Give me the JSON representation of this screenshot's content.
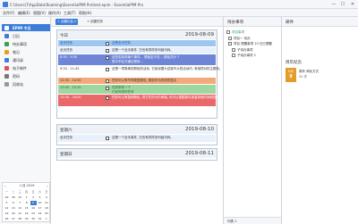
{
  "window": {
    "title": "C:\\Users\\7\\AppData\\Roaming\\EssentialPIM Pro\\test.epim - EssentialPIM Pro",
    "min": "—",
    "max": "☐",
    "close": "✕"
  },
  "menu": [
    "文件(F)",
    "编辑(E)",
    "视图(V)",
    "操作(A)",
    "工具(T)",
    "帮助(H)"
  ],
  "sidebar": {
    "items": [
      {
        "label": "EPIM 今日",
        "color": "#3b7dd8"
      },
      {
        "label": "日历",
        "color": "#3b7dd8"
      },
      {
        "label": "待办事项",
        "color": "#3aa14f"
      },
      {
        "label": "笔记",
        "color": "#e3a21a"
      },
      {
        "label": "通讯录",
        "color": "#3b7dd8"
      },
      {
        "label": "电子邮件",
        "color": "#d9534f"
      },
      {
        "label": "密码",
        "color": "#777777"
      },
      {
        "label": "回收站",
        "color": "#999999"
      }
    ]
  },
  "minical": {
    "month": "八月 2019",
    "prev": "‹",
    "next": "›",
    "dow": [
      "一",
      "二",
      "三",
      "四",
      "五",
      "六",
      "日"
    ],
    "weeks": [
      [
        "29",
        "30",
        "31",
        "1",
        "2",
        "3",
        "4"
      ],
      [
        "5",
        "6",
        "7",
        "8",
        "9",
        "10",
        "11"
      ],
      [
        "12",
        "13",
        "14",
        "15",
        "16",
        "17",
        "18"
      ],
      [
        "19",
        "20",
        "21",
        "22",
        "23",
        "24",
        "25"
      ],
      [
        "26",
        "27",
        "28",
        "29",
        "30",
        "31",
        "1"
      ]
    ],
    "selected": "9"
  },
  "toolbar": {
    "new_event": "+ 创建约会 ▾",
    "new_todo": "+ 创建任务"
  },
  "today": {
    "name": "今日",
    "date": "2019-08-09",
    "events": [
      {
        "time": "全天任务",
        "text": "这是全天任务",
        "text2": "",
        "color": "#9dc7f0",
        "textcolor": "#1a4f9c"
      },
      {
        "time": "全天任务",
        "text": "这是一个全天事件, 它也有同样多列组代码。",
        "text2": "",
        "color": "#e8f0fb",
        "textcolor": "#333333"
      },
      {
        "time": "8:30 - 9:30",
        "text": "这些实际的每个事件。 颜色定义在... 颜色共分 7",
        "text2": "类可不区分通过程序...",
        "color": "#6f86d6",
        "textcolor": "#ffffff"
      },
      {
        "time": "9:30 - 11:45",
        "text": "这是一项简单的颜色的活动, 它就设置为空缺不大的活动内, 有相同对的主题系。",
        "text2": "",
        "color": "#ffffff",
        "textcolor": "#333333"
      },
      {
        "time": "12:30 - 14:30",
        "text": "任务可以有不同类型颜色, 颜色作为完成的显示",
        "text2": "",
        "color": "#f4a97a",
        "textcolor": "#333333"
      },
      {
        "time": "15:00 - 15:30",
        "text": "任务带有一个",
        "text2": "已经完成的任务",
        "color": "#9fd7a0",
        "textcolor": "#2a6a2a"
      },
      {
        "time": "15:30 - 16:00",
        "text": "任务可以有各种颜色, 将它们作为时间轴, 你可以根据事件或者其他时间段进行显示颜色",
        "text2": "",
        "color": "#e9696b",
        "textcolor": "#ffffff"
      }
    ]
  },
  "saturday": {
    "name": "星期六",
    "date": "2019-08-10",
    "events": [
      {
        "time": "全天任务",
        "text": "这是一个全天事件, 它也有同样多列组代码。"
      }
    ]
  },
  "sunday": {
    "name": "星期日",
    "date": "2019-08-11"
  },
  "todo": {
    "title": "待办事项",
    "items": [
      {
        "label": "项目事项",
        "color": "#3aa14f"
      },
      {
        "label": "项目一 待办",
        "color": "#333333"
      },
      {
        "label": "项目 提醒事项 10 日已提醒",
        "color": "#333333"
      },
      {
        "label": "子待办事项",
        "color": "#333333"
      },
      {
        "label": "子待办事项 2",
        "color": "#333333"
      }
    ],
    "footer": "列表 1"
  },
  "notes": {
    "title": "邮件",
    "section": "周年纪念",
    "anniv_badge": "8月",
    "anniv_day": "9",
    "anniv_title": "周年 简化方式",
    "anniv_sub": "20 岁"
  }
}
